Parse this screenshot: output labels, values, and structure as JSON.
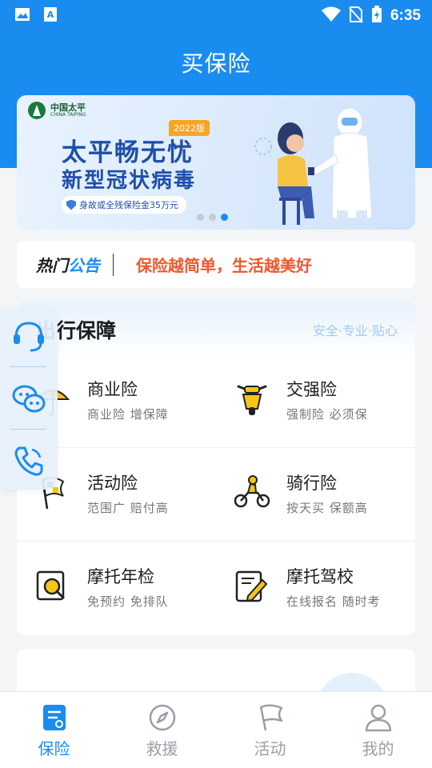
{
  "status_bar": {
    "time": "6:35"
  },
  "header": {
    "title": "买保险"
  },
  "banner": {
    "logo_cn": "中国太平",
    "logo_en": "CHINA TAIPING",
    "year_tag": "2022版",
    "headline": "太平畅无忧",
    "subheadline": "新型冠状病毒",
    "pill_text": "身故或全残保险金35万元",
    "dots_total": 3,
    "dots_active": 3
  },
  "notice": {
    "tag_part1": "热门",
    "tag_part2": "公告",
    "text": "保险越简单，生活越美好"
  },
  "services": {
    "title": "出行保障",
    "tagline": "安全·专业·贴心",
    "items": [
      {
        "name": "商业险",
        "sub": "商业险  增保障",
        "icon": "umbrella-icon"
      },
      {
        "name": "交强险",
        "sub": "强制险  必须保",
        "icon": "scooter-icon"
      },
      {
        "name": "活动险",
        "sub": "范围广  赔付高",
        "icon": "flag-icon"
      },
      {
        "name": "骑行险",
        "sub": "按天买  保额高",
        "icon": "motorcycle-rider-icon"
      },
      {
        "name": "摩托年检",
        "sub": "免预约  免排队",
        "icon": "inspection-magnifier-icon"
      },
      {
        "name": "摩托驾校",
        "sub": "在线报名  随时考",
        "icon": "exam-paper-icon"
      }
    ]
  },
  "float_bar": {
    "items": [
      "customer-service-icon",
      "chat-icon",
      "phone-icon"
    ]
  },
  "bottom_nav": {
    "items": [
      {
        "label": "保险",
        "icon": "insurance-doc-icon",
        "active": true
      },
      {
        "label": "救援",
        "icon": "compass-icon",
        "active": false
      },
      {
        "label": "活动",
        "icon": "flag-icon",
        "active": false
      },
      {
        "label": "我的",
        "icon": "user-icon",
        "active": false
      }
    ]
  },
  "colors": {
    "primary": "#1a8cf0",
    "notice_red": "#f0572d",
    "icon_yellow": "#f5c518"
  }
}
